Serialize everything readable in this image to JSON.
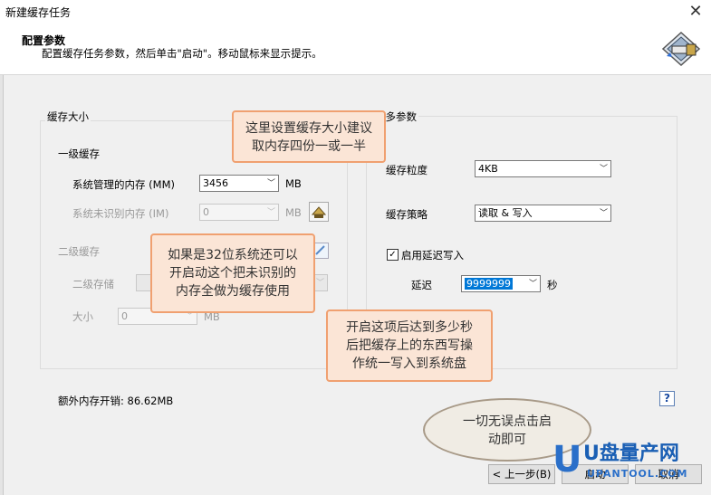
{
  "window": {
    "title": "新建缓存任务"
  },
  "header": {
    "title": "配置参数",
    "subtitle": "配置缓存任务参数，然后单击\"启动\"。移动鼠标来显示提示。"
  },
  "cache_size": {
    "group_label": "缓存大小",
    "l1_label": "一级缓存",
    "mm_label": "系统管理的内存 (MM)",
    "mm_value": "3456",
    "mm_unit": "MB",
    "im_label": "系统未识别内存 (IM)",
    "im_value": "0",
    "im_unit": "MB",
    "l2_label": "二级缓存",
    "l2_storage_label": "二级存储",
    "size_label": "大小",
    "size_value": "0",
    "size_unit": "MB"
  },
  "more_params": {
    "group_label": "更多参数",
    "granularity_label": "缓存粒度",
    "granularity_value": "4KB",
    "policy_label": "缓存策略",
    "policy_value": "读取 & 写入",
    "delay_write_label": "启用延迟写入",
    "delay_write_checked": true,
    "delay_label": "延迟",
    "delay_value": "9999999",
    "delay_unit": "秒"
  },
  "footer": {
    "extra_mem": "额外内存开销: 86.62MB",
    "help": "?",
    "back_label": "< 上一步(B)",
    "start_label": "启动",
    "cancel_label": "取消"
  },
  "annotations": {
    "tip1": [
      "这里设置缓存大小建议",
      "取内存四份一或一半"
    ],
    "tip2": [
      "如果是32位系统还可以",
      "开启动这个把未识别的",
      "内存全做为缓存使用"
    ],
    "tip3": [
      "开启这项后达到多少秒",
      "后把缓存上的东西写操",
      "作统一写入到系统盘"
    ],
    "tip4": [
      "一切无误点击启",
      "动即可"
    ]
  },
  "watermark": {
    "big": "U盘量产网",
    "small": "UPANTOOL.COM"
  }
}
